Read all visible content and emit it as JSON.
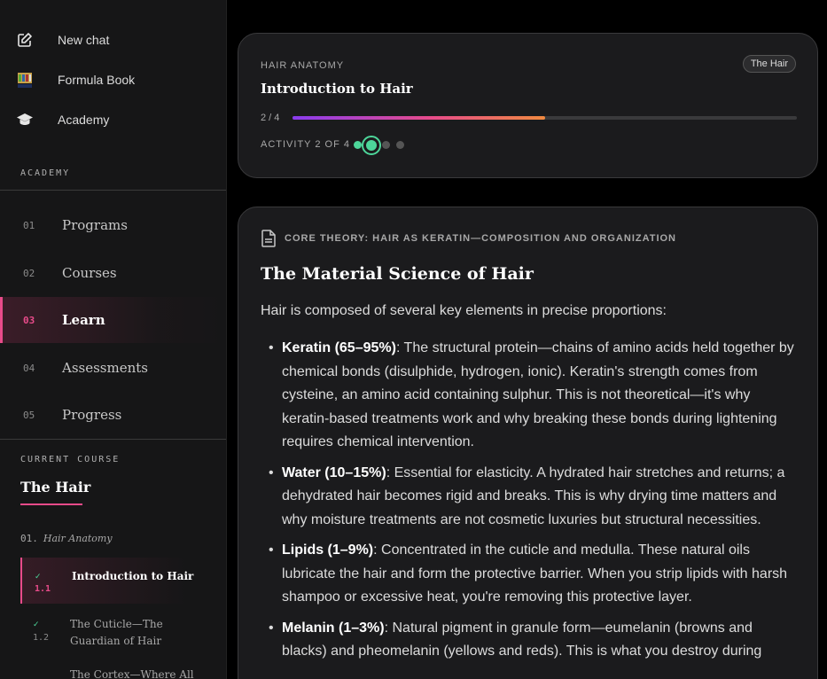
{
  "sidebar": {
    "top_items": [
      {
        "label": "New chat",
        "icon": "edit-icon"
      },
      {
        "label": "Formula Book",
        "icon": "formula-book-logo"
      },
      {
        "label": "Academy",
        "icon": "graduation-cap-icon"
      }
    ],
    "academy_label": "ACADEMY",
    "nav": [
      {
        "num": "01",
        "label": "Programs"
      },
      {
        "num": "02",
        "label": "Courses"
      },
      {
        "num": "03",
        "label": "Learn"
      },
      {
        "num": "04",
        "label": "Assessments"
      },
      {
        "num": "05",
        "label": "Progress"
      }
    ],
    "current_course_label": "CURRENT COURSE",
    "course_title": "The Hair",
    "module": {
      "num": "01.",
      "title": "Hair Anatomy"
    },
    "lessons": [
      {
        "check": "✓",
        "num": "1.1",
        "title": "Introduction to Hair"
      },
      {
        "check": "✓",
        "num": "1.2",
        "title": "The Cuticle—The Guardian of Hair"
      },
      {
        "check": "",
        "num": "",
        "title": "The Cortex—Where All"
      }
    ]
  },
  "header_card": {
    "eyebrow": "HAIR ANATOMY",
    "badge": "The Hair",
    "title": "Introduction to Hair",
    "progress_text": "2 / 4",
    "progress_fraction": 0.5,
    "activity_label": "ACTIVITY 2 OF 4"
  },
  "content": {
    "section_heading": "CORE THEORY: HAIR AS KERATIN—COMPOSITION AND ORGANIZATION",
    "title": "The Material Science of Hair",
    "intro": "Hair is composed of several key elements in precise proportions:",
    "bullets": [
      {
        "term": "Keratin (65–95%)",
        "text": ": The structural protein—chains of amino acids held together by chemical bonds (disulphide, hydrogen, ionic). Keratin's strength comes from cysteine, an amino acid containing sulphur. This is not theoretical—it's why keratin-based treatments work and why breaking these bonds during lightening requires chemical intervention."
      },
      {
        "term": "Water (10–15%)",
        "text": ": Essential for elasticity. A hydrated hair stretches and returns; a dehydrated hair becomes rigid and breaks. This is why drying time matters and why moisture treatments are not cosmetic luxuries but structural necessities."
      },
      {
        "term": "Lipids (1–9%)",
        "text": ": Concentrated in the cuticle and medulla. These natural oils lubricate the hair and form the protective barrier. When you strip lipids with harsh shampoo or excessive heat, you're removing this protective layer."
      },
      {
        "term": "Melanin (1–3%)",
        "text": ": Natural pigment in granule form—eumelanin (browns and blacks) and pheomelanin (yellows and reds). This is what you destroy during"
      }
    ]
  },
  "colors": {
    "accent": "#e84b8a",
    "success": "#4dd69a"
  }
}
